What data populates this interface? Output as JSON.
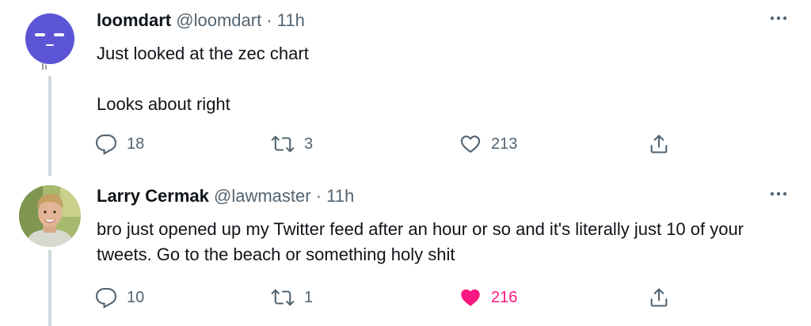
{
  "tweets": [
    {
      "display_name": "loomdart",
      "handle": "@loomdart",
      "separator": "·",
      "time": "11h",
      "body": [
        "Just looked at the zec chart",
        "Looks about right"
      ],
      "replies": "18",
      "retweets": "3",
      "likes": "213",
      "liked": false,
      "avatar_color": "#5b55d6"
    },
    {
      "display_name": "Larry Cermak",
      "handle": "@lawmaster",
      "separator": "·",
      "time": "11h",
      "body": [
        "bro just opened up my Twitter feed after an hour or so and it's literally just 10 of your tweets. Go to the beach or something holy shit"
      ],
      "replies": "10",
      "retweets": "1",
      "likes": "216",
      "liked": true
    }
  ],
  "icons": {
    "more": "more-horizontal-icon",
    "reply": "reply-icon",
    "retweet": "retweet-icon",
    "like": "heart-icon",
    "share": "share-icon"
  },
  "colors": {
    "text": "#0f1419",
    "secondary": "#536471",
    "like_active": "#f91880",
    "thread_line": "#cfd9de"
  }
}
